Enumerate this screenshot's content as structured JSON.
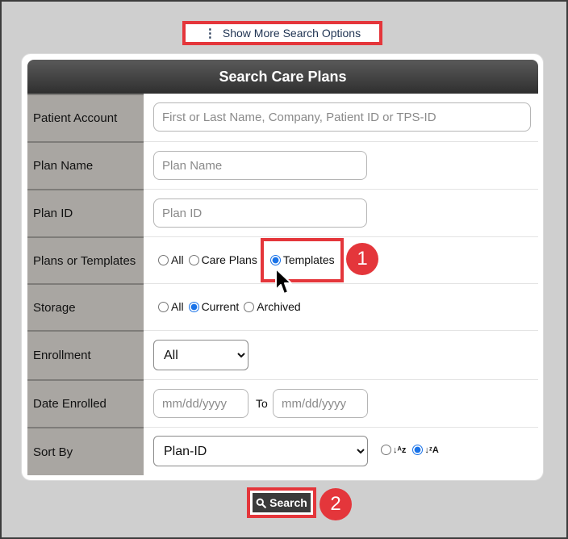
{
  "top": {
    "more_options_label": "Show More Search Options",
    "kebab_glyph": "⋮"
  },
  "panel": {
    "title": "Search Care Plans"
  },
  "fields": {
    "patient_account": {
      "label": "Patient Account",
      "placeholder": "First or Last Name, Company, Patient ID or TPS-ID"
    },
    "plan_name": {
      "label": "Plan Name",
      "placeholder": "Plan Name"
    },
    "plan_id": {
      "label": "Plan ID",
      "placeholder": "Plan ID"
    },
    "plans_or_templates": {
      "label": "Plans or Templates",
      "options": [
        "All",
        "Care Plans",
        "Templates"
      ],
      "selected": "Templates"
    },
    "storage": {
      "label": "Storage",
      "options": [
        "All",
        "Current",
        "Archived"
      ],
      "selected": "Current"
    },
    "enrollment": {
      "label": "Enrollment",
      "selected": "All"
    },
    "date_enrolled": {
      "label": "Date Enrolled",
      "from_placeholder": "mm/dd/yyyy",
      "to_label": "To",
      "to_placeholder": "mm/dd/yyyy"
    },
    "sort_by": {
      "label": "Sort By",
      "selected": "Plan-ID",
      "direction": "descending"
    }
  },
  "search_button": {
    "label": "Search",
    "icon": "magnifier-icon"
  },
  "annotations": {
    "step1": "1",
    "step2": "2",
    "color": "#e4363b"
  }
}
